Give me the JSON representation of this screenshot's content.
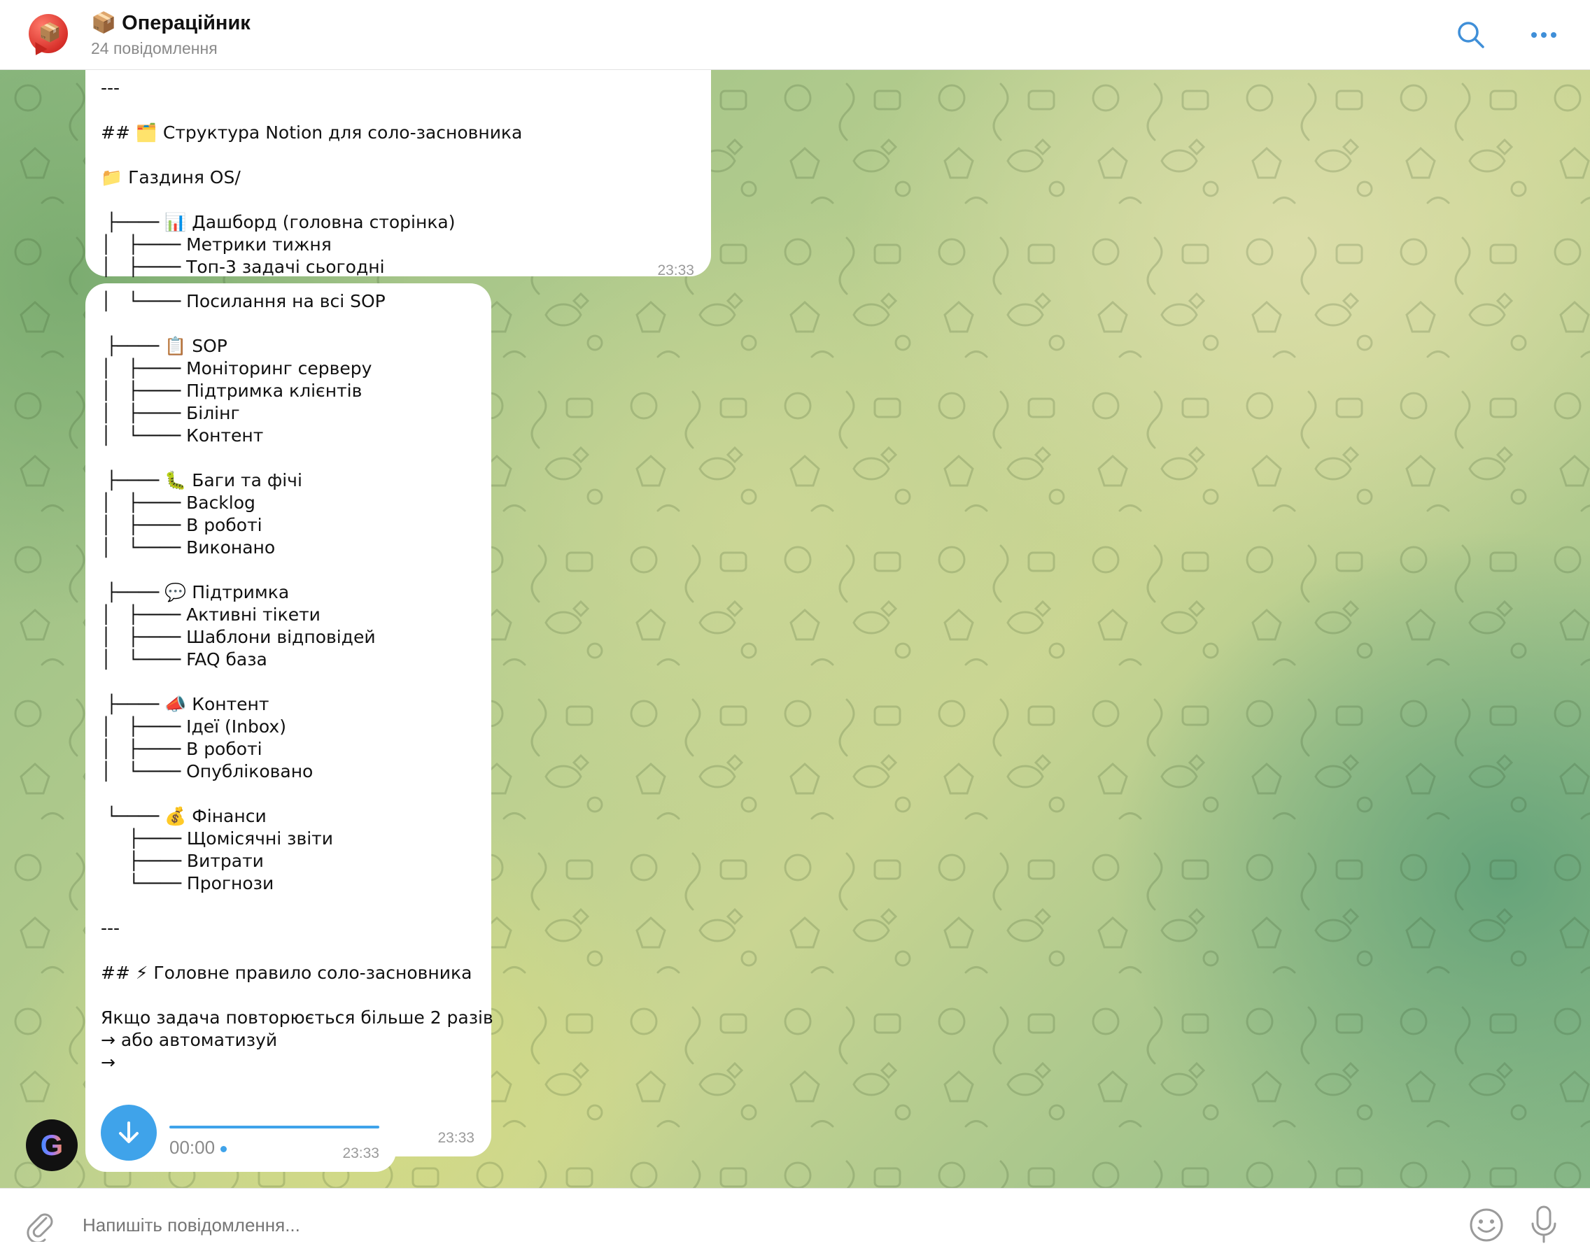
{
  "header": {
    "avatar_glyph": "📦",
    "title": "📦 Операційник",
    "subtitle": "24 повідомлення",
    "accent": "#3f8fd8"
  },
  "messages": [
    {
      "lines": [
        "---",
        "",
        "## 🗂️ Структура Notion для соло-засновника",
        "",
        "📁 Газдиня OS/",
        "",
        " ├──── 📊 Дашборд (головна сторінка)",
        "│   ├──── Метрики тижня",
        "│   ├──── Топ-3 задачі сьогодні"
      ],
      "time": "23:33"
    },
    {
      "lines": [
        "│   └──── Посилання на всі SOP",
        "",
        " ├──── 📋 SOP",
        "│   ├──── Моніторинг серверу",
        "│   ├──── Підтримка клієнтів",
        "│   ├──── Білінг",
        "│   └──── Контент",
        "",
        " ├──── 🐛 Баги та фічі",
        "│   ├──── Backlog",
        "│   ├──── В роботі",
        "│   └──── Виконано",
        "",
        " ├──── 💬 Підтримка",
        "│   ├──── Активні тікети",
        "│   ├──── Шаблони відповідей",
        "│   └──── FAQ база",
        "",
        " ├──── 📣 Контент",
        "│   ├──── Ідеї (Inbox)",
        "│   ├──── В роботі",
        "│   └──── Опубліковано",
        "",
        " └──── 💰 Фінанси",
        "     ├──── Щомісячні звіти",
        "     ├──── Витрати",
        "     └──── Прогнози",
        "",
        "---",
        "",
        "## ⚡ Головне правило соло-засновника",
        "",
        "Якщо задача повторюється більше 2 разів",
        "→ або автоматизуй",
        "→"
      ],
      "time": "23:33"
    }
  ],
  "voice": {
    "duration": "00:00",
    "time": "23:33",
    "icon": "download-arrow-icon",
    "progress": 1.0
  },
  "sender_avatar": {
    "letter": "G"
  },
  "composer": {
    "placeholder": "Напишіть повідомлення...",
    "icons": [
      "paperclip-icon",
      "emoji-icon",
      "microphone-icon"
    ]
  }
}
